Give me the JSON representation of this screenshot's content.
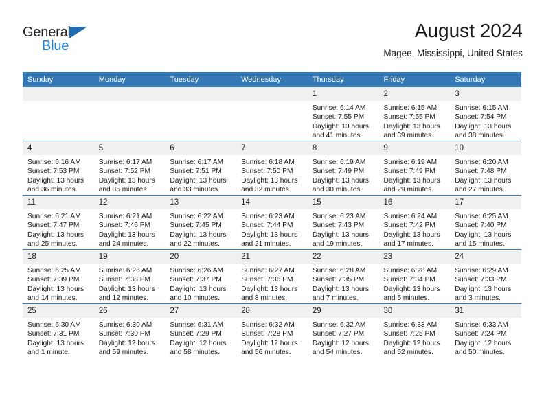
{
  "brand": {
    "name_part1": "General",
    "name_part2": "Blue",
    "triangle_icon": "triangle-icon",
    "accent_color": "#1f7fd4",
    "header_color": "#3479b5"
  },
  "header": {
    "title": "August 2024",
    "subtitle": "Magee, Mississippi, United States"
  },
  "weekday_headers": [
    "Sunday",
    "Monday",
    "Tuesday",
    "Wednesday",
    "Thursday",
    "Friday",
    "Saturday"
  ],
  "weeks": [
    [
      {
        "day": "",
        "empty": true
      },
      {
        "day": "",
        "empty": true
      },
      {
        "day": "",
        "empty": true
      },
      {
        "day": "",
        "empty": true
      },
      {
        "day": "1",
        "sunrise": "Sunrise: 6:14 AM",
        "sunset": "Sunset: 7:55 PM",
        "daylight": "Daylight: 13 hours and 41 minutes."
      },
      {
        "day": "2",
        "sunrise": "Sunrise: 6:15 AM",
        "sunset": "Sunset: 7:55 PM",
        "daylight": "Daylight: 13 hours and 39 minutes."
      },
      {
        "day": "3",
        "sunrise": "Sunrise: 6:15 AM",
        "sunset": "Sunset: 7:54 PM",
        "daylight": "Daylight: 13 hours and 38 minutes."
      }
    ],
    [
      {
        "day": "4",
        "sunrise": "Sunrise: 6:16 AM",
        "sunset": "Sunset: 7:53 PM",
        "daylight": "Daylight: 13 hours and 36 minutes."
      },
      {
        "day": "5",
        "sunrise": "Sunrise: 6:17 AM",
        "sunset": "Sunset: 7:52 PM",
        "daylight": "Daylight: 13 hours and 35 minutes."
      },
      {
        "day": "6",
        "sunrise": "Sunrise: 6:17 AM",
        "sunset": "Sunset: 7:51 PM",
        "daylight": "Daylight: 13 hours and 33 minutes."
      },
      {
        "day": "7",
        "sunrise": "Sunrise: 6:18 AM",
        "sunset": "Sunset: 7:50 PM",
        "daylight": "Daylight: 13 hours and 32 minutes."
      },
      {
        "day": "8",
        "sunrise": "Sunrise: 6:19 AM",
        "sunset": "Sunset: 7:49 PM",
        "daylight": "Daylight: 13 hours and 30 minutes."
      },
      {
        "day": "9",
        "sunrise": "Sunrise: 6:19 AM",
        "sunset": "Sunset: 7:49 PM",
        "daylight": "Daylight: 13 hours and 29 minutes."
      },
      {
        "day": "10",
        "sunrise": "Sunrise: 6:20 AM",
        "sunset": "Sunset: 7:48 PM",
        "daylight": "Daylight: 13 hours and 27 minutes."
      }
    ],
    [
      {
        "day": "11",
        "sunrise": "Sunrise: 6:21 AM",
        "sunset": "Sunset: 7:47 PM",
        "daylight": "Daylight: 13 hours and 25 minutes."
      },
      {
        "day": "12",
        "sunrise": "Sunrise: 6:21 AM",
        "sunset": "Sunset: 7:46 PM",
        "daylight": "Daylight: 13 hours and 24 minutes."
      },
      {
        "day": "13",
        "sunrise": "Sunrise: 6:22 AM",
        "sunset": "Sunset: 7:45 PM",
        "daylight": "Daylight: 13 hours and 22 minutes."
      },
      {
        "day": "14",
        "sunrise": "Sunrise: 6:23 AM",
        "sunset": "Sunset: 7:44 PM",
        "daylight": "Daylight: 13 hours and 21 minutes."
      },
      {
        "day": "15",
        "sunrise": "Sunrise: 6:23 AM",
        "sunset": "Sunset: 7:43 PM",
        "daylight": "Daylight: 13 hours and 19 minutes."
      },
      {
        "day": "16",
        "sunrise": "Sunrise: 6:24 AM",
        "sunset": "Sunset: 7:42 PM",
        "daylight": "Daylight: 13 hours and 17 minutes."
      },
      {
        "day": "17",
        "sunrise": "Sunrise: 6:25 AM",
        "sunset": "Sunset: 7:40 PM",
        "daylight": "Daylight: 13 hours and 15 minutes."
      }
    ],
    [
      {
        "day": "18",
        "sunrise": "Sunrise: 6:25 AM",
        "sunset": "Sunset: 7:39 PM",
        "daylight": "Daylight: 13 hours and 14 minutes."
      },
      {
        "day": "19",
        "sunrise": "Sunrise: 6:26 AM",
        "sunset": "Sunset: 7:38 PM",
        "daylight": "Daylight: 13 hours and 12 minutes."
      },
      {
        "day": "20",
        "sunrise": "Sunrise: 6:26 AM",
        "sunset": "Sunset: 7:37 PM",
        "daylight": "Daylight: 13 hours and 10 minutes."
      },
      {
        "day": "21",
        "sunrise": "Sunrise: 6:27 AM",
        "sunset": "Sunset: 7:36 PM",
        "daylight": "Daylight: 13 hours and 8 minutes."
      },
      {
        "day": "22",
        "sunrise": "Sunrise: 6:28 AM",
        "sunset": "Sunset: 7:35 PM",
        "daylight": "Daylight: 13 hours and 7 minutes."
      },
      {
        "day": "23",
        "sunrise": "Sunrise: 6:28 AM",
        "sunset": "Sunset: 7:34 PM",
        "daylight": "Daylight: 13 hours and 5 minutes."
      },
      {
        "day": "24",
        "sunrise": "Sunrise: 6:29 AM",
        "sunset": "Sunset: 7:33 PM",
        "daylight": "Daylight: 13 hours and 3 minutes."
      }
    ],
    [
      {
        "day": "25",
        "sunrise": "Sunrise: 6:30 AM",
        "sunset": "Sunset: 7:31 PM",
        "daylight": "Daylight: 13 hours and 1 minute."
      },
      {
        "day": "26",
        "sunrise": "Sunrise: 6:30 AM",
        "sunset": "Sunset: 7:30 PM",
        "daylight": "Daylight: 12 hours and 59 minutes."
      },
      {
        "day": "27",
        "sunrise": "Sunrise: 6:31 AM",
        "sunset": "Sunset: 7:29 PM",
        "daylight": "Daylight: 12 hours and 58 minutes."
      },
      {
        "day": "28",
        "sunrise": "Sunrise: 6:32 AM",
        "sunset": "Sunset: 7:28 PM",
        "daylight": "Daylight: 12 hours and 56 minutes."
      },
      {
        "day": "29",
        "sunrise": "Sunrise: 6:32 AM",
        "sunset": "Sunset: 7:27 PM",
        "daylight": "Daylight: 12 hours and 54 minutes."
      },
      {
        "day": "30",
        "sunrise": "Sunrise: 6:33 AM",
        "sunset": "Sunset: 7:25 PM",
        "daylight": "Daylight: 12 hours and 52 minutes."
      },
      {
        "day": "31",
        "sunrise": "Sunrise: 6:33 AM",
        "sunset": "Sunset: 7:24 PM",
        "daylight": "Daylight: 12 hours and 50 minutes."
      }
    ]
  ]
}
